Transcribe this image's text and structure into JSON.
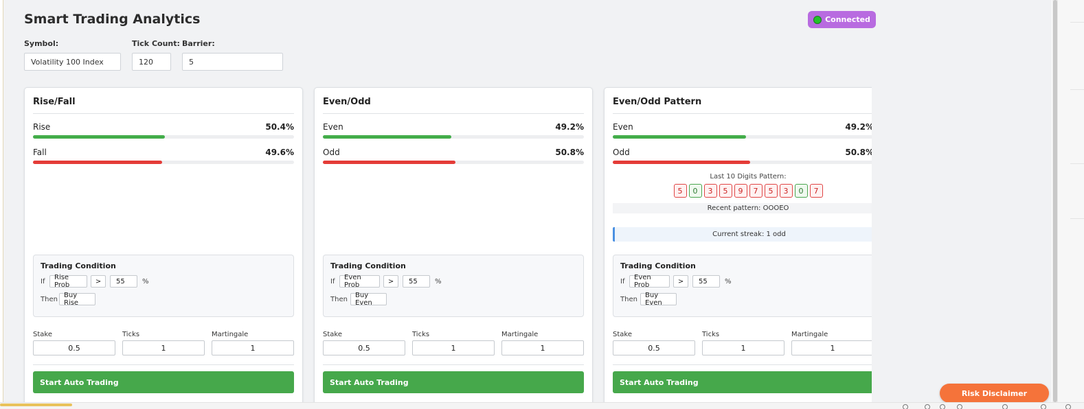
{
  "header": {
    "title": "Smart Trading Analytics",
    "status": "Connected",
    "status_color": "#b86be0"
  },
  "controls": {
    "symbol_label": "Symbol:",
    "symbol_value": "Volatility 100 Index",
    "tick_count_label": "Tick Count:",
    "tick_count_value": "120",
    "barrier_label": "Barrier:",
    "barrier_value": "5"
  },
  "colors": {
    "up": "#43ad4a",
    "down": "#e43c38",
    "start": "#46a84b",
    "disclaimer": "#f5733a"
  },
  "cards": [
    {
      "title": "Rise/Fall",
      "bars": [
        {
          "label": "Rise",
          "value_text": "50.4%",
          "percent": 50.4,
          "color": "green"
        },
        {
          "label": "Fall",
          "value_text": "49.6%",
          "percent": 49.6,
          "color": "red"
        }
      ],
      "condition": {
        "title": "Trading Condition",
        "if_word": "If",
        "metric": "Rise Prob",
        "operator": ">",
        "threshold": "55",
        "unit": "%",
        "then_word": "Then",
        "action": "Buy Rise"
      },
      "stake_label": "Stake",
      "stake_value": "0.5",
      "ticks_label": "Ticks",
      "ticks_value": "1",
      "martingale_label": "Martingale",
      "martingale_value": "1",
      "start_label": "Start Auto Trading"
    },
    {
      "title": "Even/Odd",
      "bars": [
        {
          "label": "Even",
          "value_text": "49.2%",
          "percent": 49.2,
          "color": "green"
        },
        {
          "label": "Odd",
          "value_text": "50.8%",
          "percent": 50.8,
          "color": "red"
        }
      ],
      "condition": {
        "title": "Trading Condition",
        "if_word": "If",
        "metric": "Even Prob",
        "operator": ">",
        "threshold": "55",
        "unit": "%",
        "then_word": "Then",
        "action": "Buy Even"
      },
      "stake_label": "Stake",
      "stake_value": "0.5",
      "ticks_label": "Ticks",
      "ticks_value": "1",
      "martingale_label": "Martingale",
      "martingale_value": "1",
      "start_label": "Start Auto Trading"
    },
    {
      "title": "Even/Odd Pattern",
      "bars": [
        {
          "label": "Even",
          "value_text": "49.2%",
          "percent": 49.2,
          "color": "green"
        },
        {
          "label": "Odd",
          "value_text": "50.8%",
          "percent": 50.8,
          "color": "red"
        }
      ],
      "pattern": {
        "label": "Last 10 Digits Pattern:",
        "digits": [
          "5",
          "0",
          "3",
          "5",
          "9",
          "7",
          "5",
          "3",
          "0",
          "7"
        ],
        "recent": "Recent pattern: OOOEO",
        "streak": "Current streak: 1 odd"
      },
      "condition": {
        "title": "Trading Condition",
        "if_word": "If",
        "metric": "Even Prob",
        "operator": ">",
        "threshold": "55",
        "unit": "%",
        "then_word": "Then",
        "action": "Buy Even"
      },
      "stake_label": "Stake",
      "stake_value": "0.5",
      "ticks_label": "Ticks",
      "ticks_value": "1",
      "martingale_label": "Martingale",
      "martingale_value": "1",
      "start_label": "Start Auto Trading"
    }
  ],
  "footer": {
    "risk_disclaimer": "Risk Disclaimer"
  }
}
